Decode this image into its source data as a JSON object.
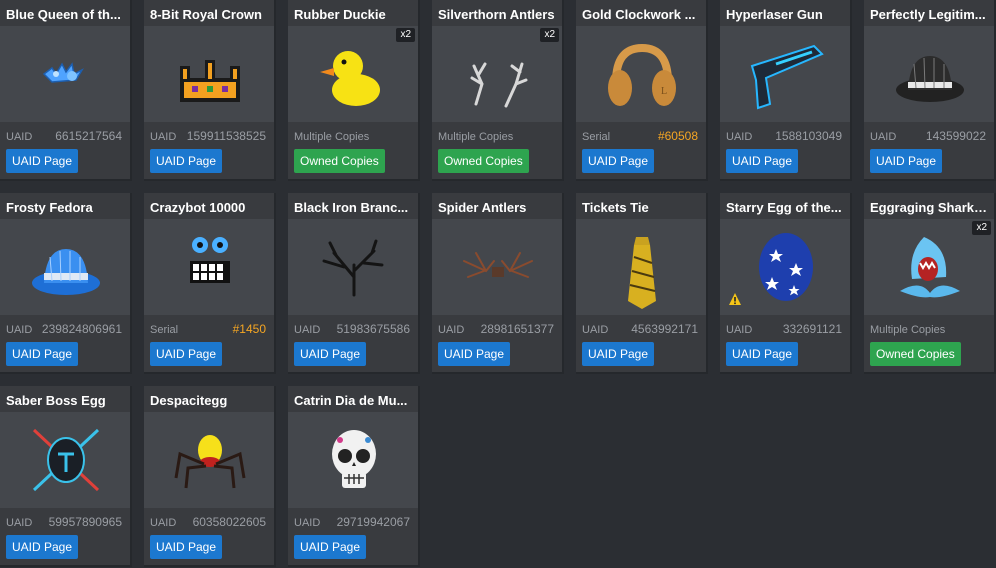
{
  "items": [
    {
      "name": "Blue Queen of th...",
      "label": "UAID",
      "value": "6615217564",
      "button": "UAID Page",
      "button_type": "uaid",
      "icon": "blue-crown-icon"
    },
    {
      "name": "8-Bit Royal Crown",
      "label": "UAID",
      "value": "159911538525",
      "button": "UAID Page",
      "button_type": "uaid",
      "icon": "pixel-crown-icon"
    },
    {
      "name": "Rubber Duckie",
      "label": "Multiple Copies",
      "value": "",
      "button": "Owned Copies",
      "button_type": "owned",
      "badge": "x2",
      "icon": "rubber-duck-icon"
    },
    {
      "name": "Silverthorn Antlers",
      "label": "Multiple Copies",
      "value": "",
      "button": "Owned Copies",
      "button_type": "owned",
      "badge": "x2",
      "icon": "antlers-icon"
    },
    {
      "name": "Gold Clockwork ...",
      "label": "Serial",
      "value": "#60508",
      "value_type": "serial",
      "button": "UAID Page",
      "button_type": "uaid",
      "icon": "headphones-icon"
    },
    {
      "name": "Hyperlaser Gun",
      "label": "UAID",
      "value": "1588103049",
      "button": "UAID Page",
      "button_type": "uaid",
      "icon": "laser-gun-icon"
    },
    {
      "name": "Perfectly Legitim...",
      "label": "UAID",
      "value": "143599022",
      "button": "UAID Page",
      "button_type": "uaid",
      "icon": "fedora-black-icon"
    },
    {
      "name": "Frosty Fedora",
      "label": "UAID",
      "value": "239824806961",
      "button": "UAID Page",
      "button_type": "uaid",
      "icon": "fedora-blue-icon"
    },
    {
      "name": "Crazybot 10000",
      "label": "Serial",
      "value": "#1450",
      "value_type": "serial",
      "button": "UAID Page",
      "button_type": "uaid",
      "icon": "robot-face-icon"
    },
    {
      "name": "Black Iron Branc...",
      "label": "UAID",
      "value": "51983675586",
      "button": "UAID Page",
      "button_type": "uaid",
      "icon": "branches-icon"
    },
    {
      "name": "Spider Antlers",
      "label": "UAID",
      "value": "28981651377",
      "button": "UAID Page",
      "button_type": "uaid",
      "icon": "spider-antlers-icon"
    },
    {
      "name": "Tickets Tie",
      "label": "UAID",
      "value": "4563992171",
      "button": "UAID Page",
      "button_type": "uaid",
      "icon": "tie-icon"
    },
    {
      "name": "Starry Egg of the...",
      "label": "UAID",
      "value": "332691121",
      "button": "UAID Page",
      "button_type": "uaid",
      "warning": true,
      "icon": "starry-egg-icon"
    },
    {
      "name": "Eggraging Shark ...",
      "label": "Multiple Copies",
      "value": "",
      "button": "Owned Copies",
      "button_type": "owned",
      "badge": "x2",
      "icon": "shark-icon"
    },
    {
      "name": "Saber Boss Egg",
      "label": "UAID",
      "value": "59957890965",
      "button": "UAID Page",
      "button_type": "uaid",
      "icon": "saber-egg-icon"
    },
    {
      "name": "Despacitegg",
      "label": "UAID",
      "value": "60358022605",
      "button": "UAID Page",
      "button_type": "uaid",
      "icon": "spider-egg-icon"
    },
    {
      "name": "Catrin Dia de Mu...",
      "label": "UAID",
      "value": "29719942067",
      "button": "UAID Page",
      "button_type": "uaid",
      "icon": "skull-icon"
    }
  ],
  "colors": {
    "background": "#2b2e33",
    "card": "#393b3f",
    "thumb": "#44474c",
    "uaid_button": "#1c78cf",
    "owned_button": "#2ea44f",
    "serial": "#f5a623",
    "muted": "#9a9ea4"
  }
}
